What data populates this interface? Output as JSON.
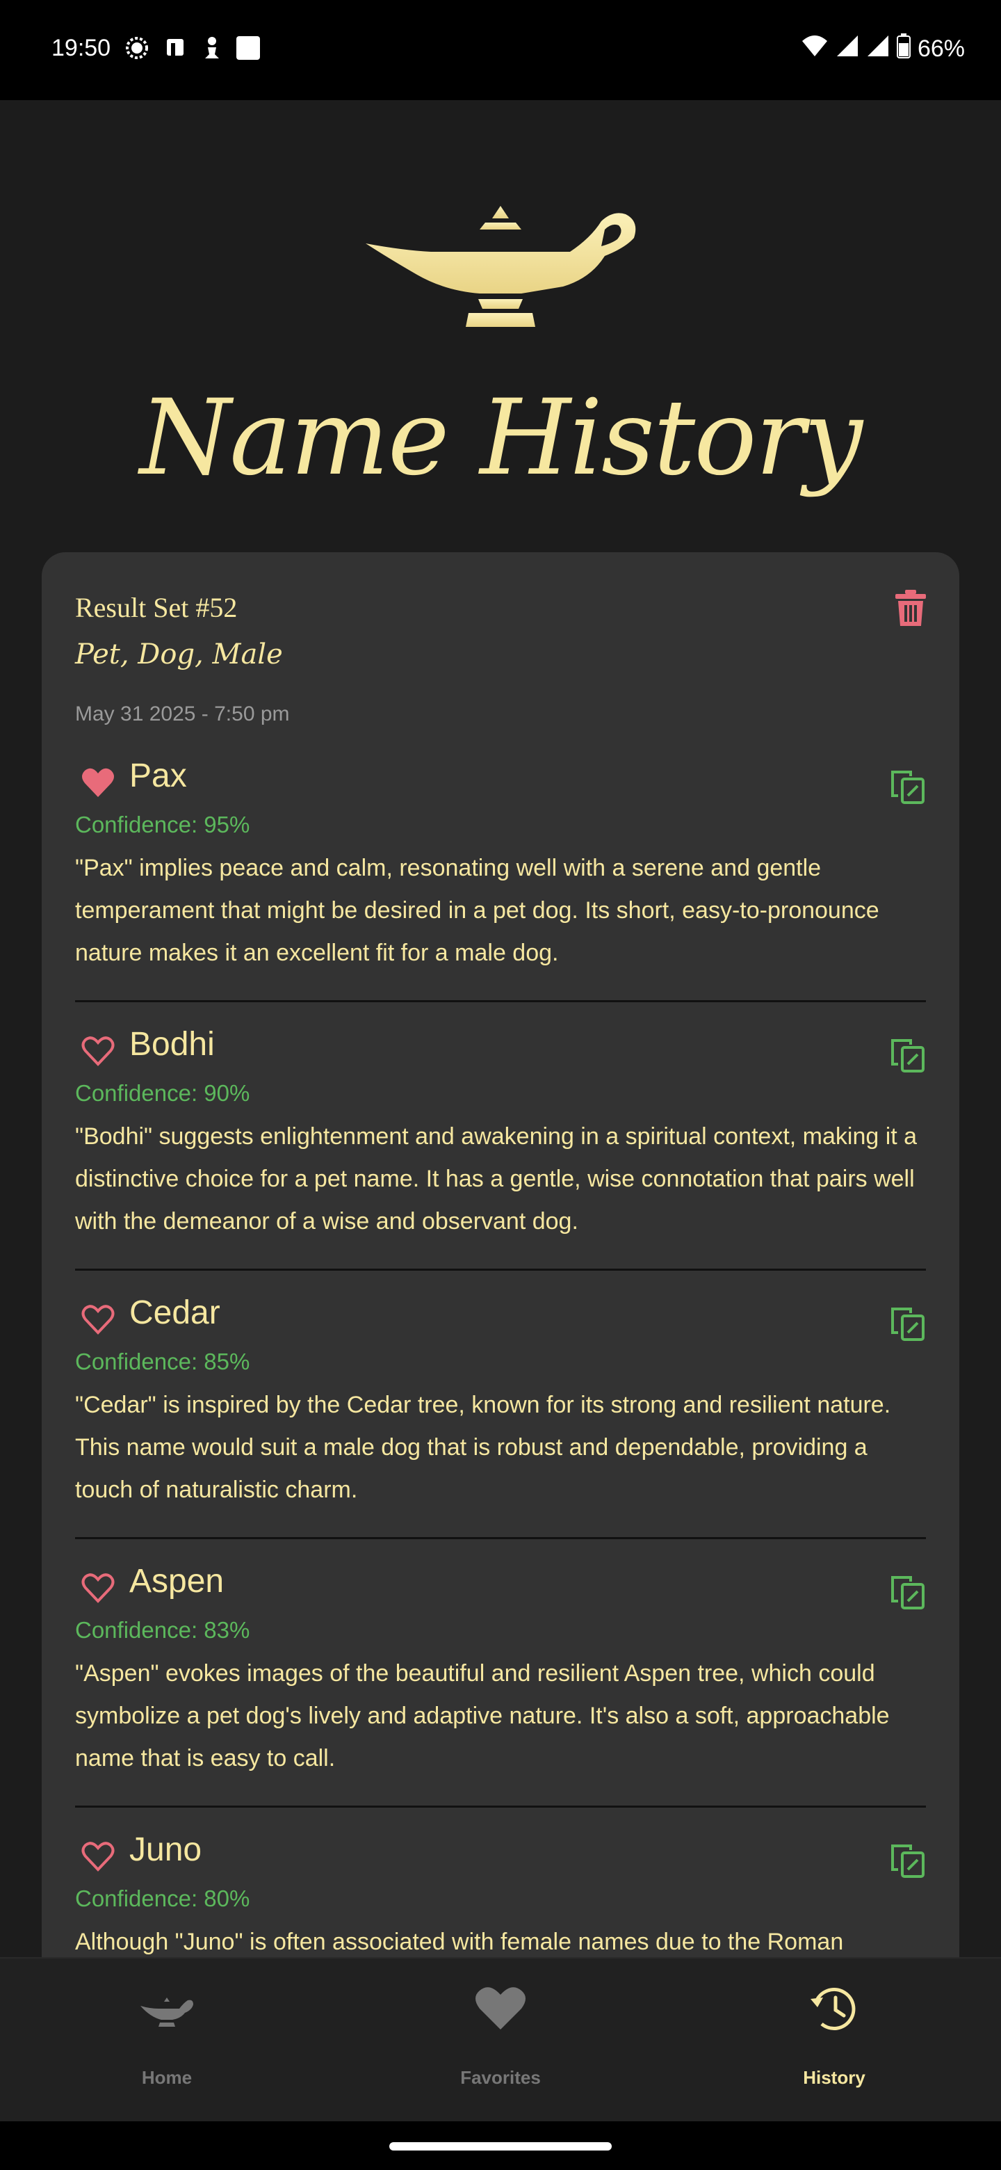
{
  "status_bar": {
    "time": "19:50",
    "battery": "66%"
  },
  "header": {
    "title": "Name History"
  },
  "result_set": {
    "title": "Result Set #52",
    "subtitle": "Pet, Dog, Male",
    "date": "May 31 2025 - 7:50 pm"
  },
  "entries": [
    {
      "name": "Pax",
      "favorited": true,
      "confidence": "Confidence: 95%",
      "description": "\"Pax\" implies peace and calm, resonating well with a serene and gentle temperament that might be desired in a pet dog. Its short, easy-to-pronounce nature makes it an excellent fit for a male dog."
    },
    {
      "name": "Bodhi",
      "favorited": false,
      "confidence": "Confidence: 90%",
      "description": "\"Bodhi\" suggests enlightenment and awakening in a spiritual context, making it a distinctive choice for a pet name. It has a gentle, wise connotation that pairs well with the demeanor of a wise and observant dog."
    },
    {
      "name": "Cedar",
      "favorited": false,
      "confidence": "Confidence: 85%",
      "description": "\"Cedar\" is inspired by the Cedar tree, known for its strong and resilient nature. This name would suit a male dog that is robust and dependable, providing a touch of naturalistic charm."
    },
    {
      "name": "Aspen",
      "favorited": false,
      "confidence": "Confidence: 83%",
      "description": "\"Aspen\" evokes images of the beautiful and resilient Aspen tree, which could symbolize a pet dog's lively and adaptive nature. It's also a soft, approachable name that is easy to call."
    },
    {
      "name": "Juno",
      "favorited": false,
      "confidence": "Confidence: 80%",
      "description": "Although \"Juno\" is often associated with female names due to the Roman goddess, it is neutral enough to be used for a male pet, suggesting nobility"
    }
  ],
  "bottom_nav": {
    "home": "Home",
    "favorites": "Favorites",
    "history": "History",
    "active": "history"
  },
  "colors": {
    "accent": "#f6e7a0",
    "heart": "#e86b7a",
    "confidence": "#5cb85c",
    "card": "#333333",
    "background": "#1c1c1c"
  }
}
